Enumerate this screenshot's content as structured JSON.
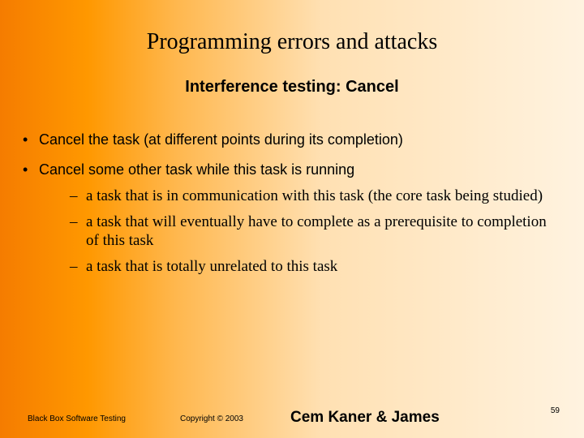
{
  "title": "Programming errors and attacks",
  "subtitle": "Interference testing: Cancel",
  "bullets": [
    {
      "text": "Cancel the task (at different points during its completion)",
      "children": []
    },
    {
      "text": "Cancel some other task while this task is running",
      "children": [
        "a task that is in communication with this task (the core task being studied)",
        "a task that will eventually have to complete as a prerequisite to completion of this task",
        "a task that is totally unrelated to this task"
      ]
    }
  ],
  "footer": {
    "left": "Black Box Software Testing",
    "mid": "Copyright ©  2003",
    "authors": "Cem Kaner & James",
    "page": "59"
  }
}
